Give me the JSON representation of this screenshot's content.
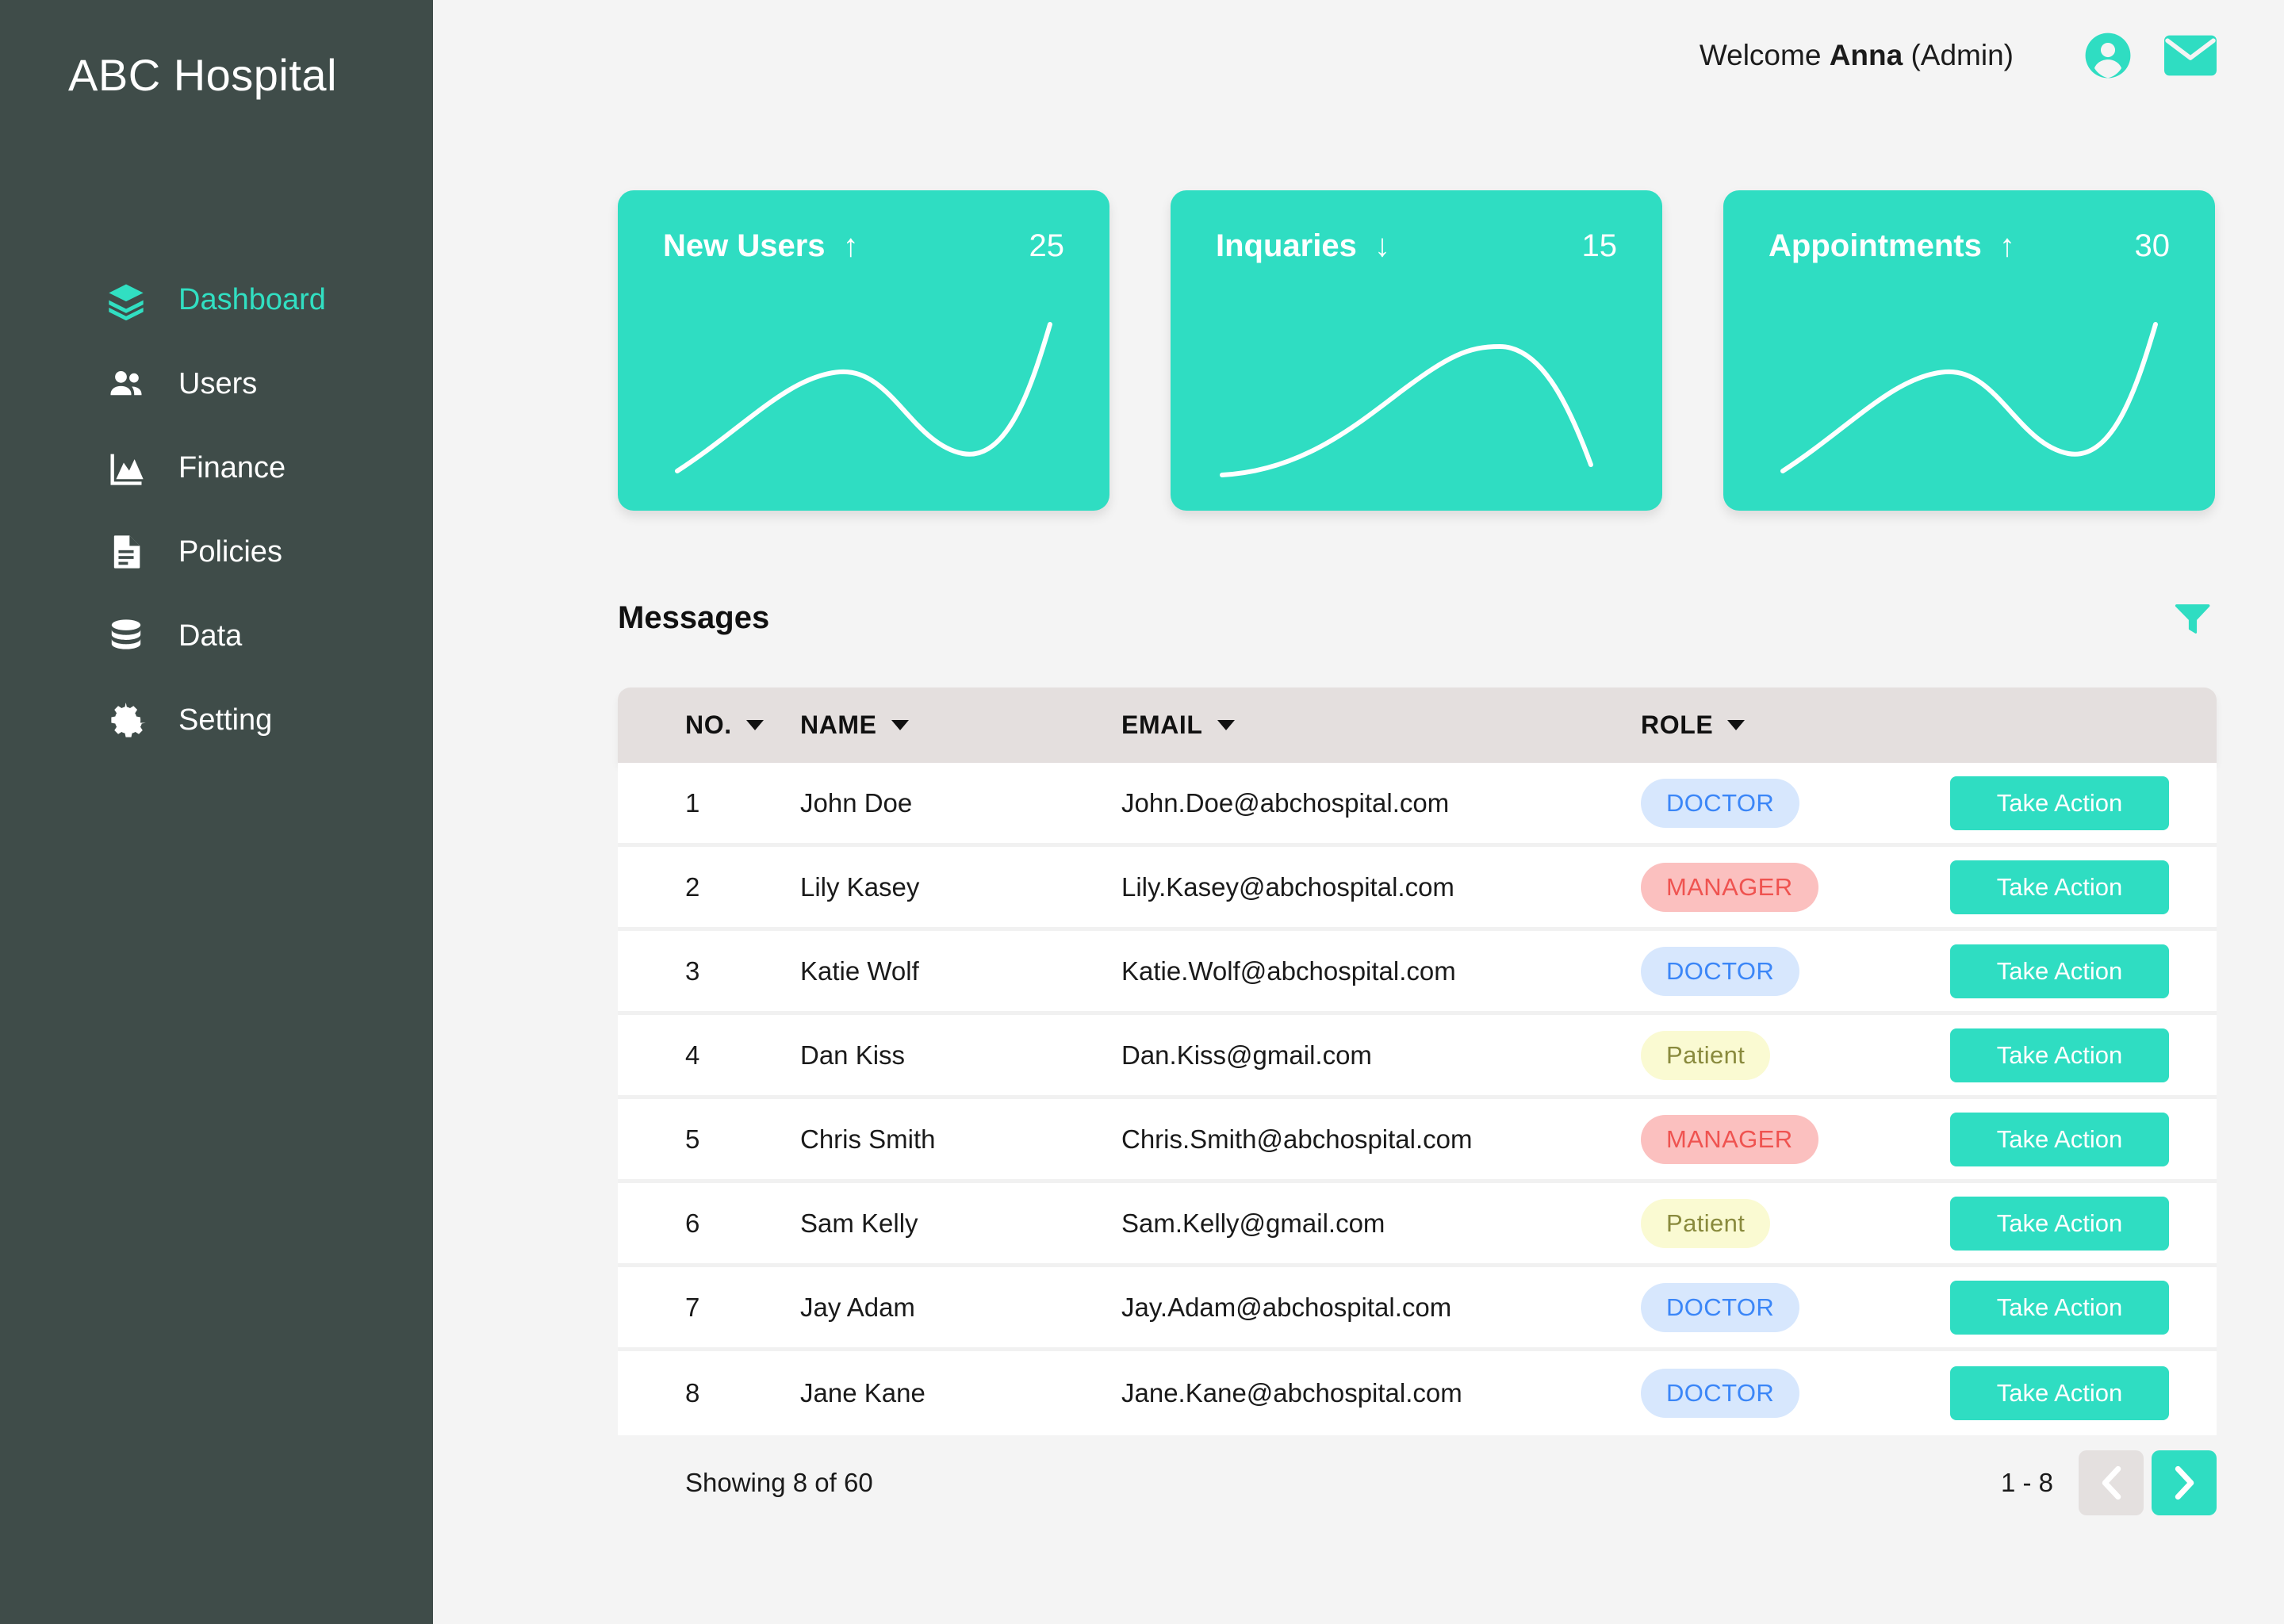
{
  "sidebar": {
    "brand": "ABC Hospital",
    "items": [
      {
        "label": "Dashboard",
        "icon": "layers-icon",
        "active": true
      },
      {
        "label": "Users",
        "icon": "users-icon",
        "active": false
      },
      {
        "label": "Finance",
        "icon": "chart-area-icon",
        "active": false
      },
      {
        "label": "Policies",
        "icon": "document-icon",
        "active": false
      },
      {
        "label": "Data",
        "icon": "database-icon",
        "active": false
      },
      {
        "label": "Setting",
        "icon": "gear-icon",
        "active": false
      }
    ]
  },
  "header": {
    "welcome_prefix": "Welcome ",
    "user_name": "Anna",
    "user_role": " (Admin)",
    "avatar_icon": "user-circle-icon",
    "mail_icon": "envelope-icon"
  },
  "cards": [
    {
      "title": "New Users",
      "trend": "↑",
      "value": "25",
      "spark": "rise-dip-rise"
    },
    {
      "title": "Inquaries",
      "trend": "↓",
      "value": "15",
      "spark": "rise-fall"
    },
    {
      "title": "Appointments",
      "trend": "↑",
      "value": "30",
      "spark": "rise-dip-rise"
    }
  ],
  "messages": {
    "title": "Messages",
    "filter_icon": "filter-icon",
    "columns": [
      "NO.",
      "NAME",
      "EMAIL",
      "ROLE"
    ],
    "action_label": "Take Action",
    "rows": [
      {
        "no": "1",
        "name": "John Doe",
        "email": "John.Doe@abchospital.com",
        "role": "DOCTOR",
        "role_key": "DOCTOR"
      },
      {
        "no": "2",
        "name": "Lily Kasey",
        "email": "Lily.Kasey@abchospital.com",
        "role": "MANAGER",
        "role_key": "MANAGER"
      },
      {
        "no": "3",
        "name": "Katie Wolf",
        "email": "Katie.Wolf@abchospital.com",
        "role": "DOCTOR",
        "role_key": "DOCTOR"
      },
      {
        "no": "4",
        "name": "Dan Kiss",
        "email": "Dan.Kiss@gmail.com",
        "role": "Patient",
        "role_key": "Patient"
      },
      {
        "no": "5",
        "name": "Chris Smith",
        "email": "Chris.Smith@abchospital.com",
        "role": "MANAGER",
        "role_key": "MANAGER"
      },
      {
        "no": "6",
        "name": "Sam Kelly",
        "email": "Sam.Kelly@gmail.com",
        "role": "Patient",
        "role_key": "Patient"
      },
      {
        "no": "7",
        "name": "Jay Adam",
        "email": "Jay.Adam@abchospital.com",
        "role": "DOCTOR",
        "role_key": "DOCTOR"
      },
      {
        "no": "8",
        "name": "Jane Kane",
        "email": "Jane.Kane@abchospital.com",
        "role": "DOCTOR",
        "role_key": "DOCTOR"
      }
    ],
    "footer": {
      "showing": "Showing 8 of 60",
      "range": "1 - 8",
      "prev_icon": "chevron-left-icon",
      "next_icon": "chevron-right-icon"
    }
  },
  "colors": {
    "accent": "#2FDDC2",
    "sidebar_bg": "#3F4C49",
    "page_bg": "#F4F4F4",
    "table_header_bg": "#E4DFDE",
    "doctor_bg": "#D7E7FD",
    "doctor_fg": "#3B86F7",
    "manager_bg": "#FBC0BF",
    "manager_fg": "#EF5350",
    "patient_bg": "#FAFAD2",
    "patient_fg": "#898A3D"
  }
}
